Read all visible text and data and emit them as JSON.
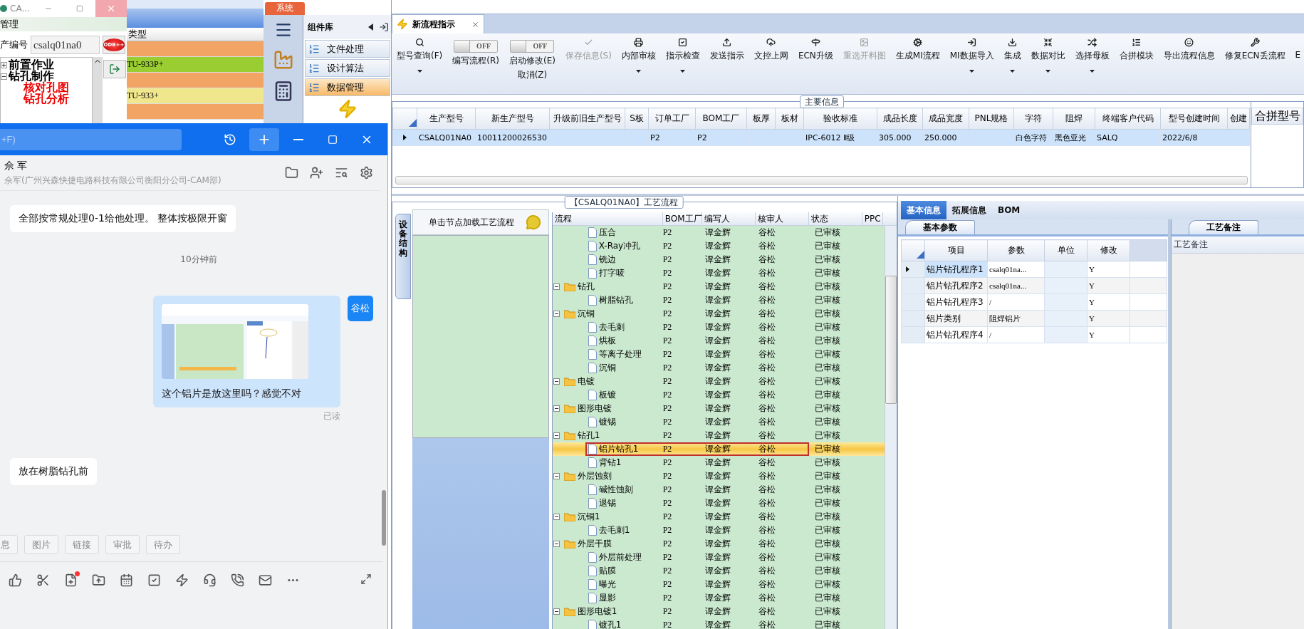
{
  "cam_window": {
    "title": "CA...",
    "section": "管理",
    "field_label": "产编号",
    "field_value": "csalq01na0",
    "odb_label": "ODB++",
    "tree": [
      {
        "label": "前置作业",
        "expanded": false
      },
      {
        "label": "钻孔制作",
        "expanded": true,
        "children": [
          {
            "label": "核对孔图"
          },
          {
            "label": "钻孔分析"
          }
        ]
      }
    ]
  },
  "type_list": {
    "column": "类型",
    "rows": [
      {
        "color": "#f2a464"
      },
      {
        "label": "TU-933P+",
        "color": "#9acd32"
      },
      {
        "color": "#f2a464"
      },
      {
        "label": "TU-933+",
        "color": "#f0e68c"
      },
      {
        "color": "#f2a464"
      }
    ]
  },
  "system_panel": {
    "tab": "系统",
    "library_title": "组件库",
    "items": [
      {
        "label": "文件处理",
        "selected": false
      },
      {
        "label": "设计算法",
        "selected": false
      },
      {
        "label": "数据管理",
        "selected": true
      }
    ]
  },
  "chat": {
    "search_placeholder": "+F)",
    "contact_name": "佘 军",
    "contact_detail": "佘军(广州兴森快捷电路科技有限公司衡阳分公司-CAM部)",
    "messages": [
      {
        "kind": "incoming",
        "text": "全部按常规处理0-1给他处理。 整体按极限开窗"
      },
      {
        "kind": "time",
        "text": "10分钟前"
      },
      {
        "kind": "outgoing",
        "text": "这个铝片是放这里吗？感觉不对",
        "avatar": "谷松",
        "receipt": "已读"
      },
      {
        "kind": "incoming",
        "text": "放在树脂钻孔前"
      }
    ],
    "chips": [
      "息",
      "图片",
      "链接",
      "审批",
      "待办"
    ],
    "notification": true
  },
  "app": {
    "tab": {
      "label": "新流程指示"
    },
    "toolbar": [
      {
        "kind": "button",
        "label": "型号查询(F)",
        "dropdown": true,
        "disabled": false
      },
      {
        "kind": "toggle",
        "label": "编写流程(R)",
        "state_label": "OFF",
        "on": false
      },
      {
        "kind": "toggle",
        "label": "启动修改(E)",
        "label2": "取消(Z)",
        "state_label": "OFF",
        "on": false
      },
      {
        "kind": "button",
        "label": "保存信息(S)",
        "dropdown": false,
        "disabled": true
      },
      {
        "kind": "button",
        "label": "内部审核",
        "dropdown": true,
        "disabled": false
      },
      {
        "kind": "button",
        "label": "指示检查",
        "dropdown": true,
        "disabled": false
      },
      {
        "kind": "button",
        "label": "发送指示",
        "dropdown": false,
        "disabled": false
      },
      {
        "kind": "button",
        "label": "文控上网",
        "dropdown": false,
        "disabled": false
      },
      {
        "kind": "button",
        "label": "ECN升级",
        "dropdown": false,
        "disabled": false
      },
      {
        "kind": "button",
        "label": "重选开料图",
        "dropdown": false,
        "disabled": true
      },
      {
        "kind": "button",
        "label": "生成MI流程",
        "dropdown": false,
        "disabled": false
      },
      {
        "kind": "button",
        "label": "MI数据导入",
        "dropdown": true,
        "disabled": false
      },
      {
        "kind": "button",
        "label": "集成",
        "dropdown": true,
        "disabled": false
      },
      {
        "kind": "button",
        "label": "数据对比",
        "dropdown": true,
        "disabled": false
      },
      {
        "kind": "button",
        "label": "选择母板",
        "dropdown": true,
        "disabled": false
      },
      {
        "kind": "button",
        "label": "合拼模块",
        "dropdown": false,
        "disabled": false
      },
      {
        "kind": "button",
        "label": "导出流程信息",
        "dropdown": false,
        "disabled": false
      },
      {
        "kind": "button",
        "label": "修复ECN丢流程",
        "dropdown": false,
        "disabled": false
      },
      {
        "kind": "button",
        "label": "E",
        "dropdown": false,
        "disabled": false
      }
    ],
    "main_info": {
      "title": "主要信息",
      "side_title": "合拼型号",
      "columns": [
        "生产型号",
        "新生产型号",
        "升级前旧生产型号",
        "S板",
        "订单工厂",
        "BOM工厂",
        "板厚",
        "板材",
        "验收标准",
        "成品长度",
        "成品宽度",
        "PNL规格",
        "字符",
        "阻焊",
        "终端客户代码",
        "型号创建时间",
        "创建"
      ],
      "rows": [
        {
          "selected": true,
          "cells": [
            "CSALQ01NA0",
            "10011200026530",
            "",
            "",
            "P2",
            "P2",
            "",
            "",
            "IPC-6012 Ⅱ级",
            "305.000",
            "250.000",
            "",
            "白色字符",
            "黑色亚光",
            "SALQ",
            "2022/6/8",
            ""
          ]
        }
      ]
    },
    "process": {
      "title": "【CSALQ01NA0】工艺流程",
      "side_tab": "设备结构",
      "hint": "单击节点加载工艺流程",
      "columns": [
        "流程",
        "BOM工厂",
        "编写人",
        "核审人",
        "状态",
        "PPC"
      ],
      "tree": [
        {
          "kind": "continued",
          "children": [
            {
              "kind": "file",
              "name": "压合",
              "bom": "P2",
              "writer": "谭金辉",
              "reviewer": "谷松",
              "status": "已审核",
              "selected": false
            },
            {
              "kind": "file",
              "name": "X-Ray冲孔",
              "bom": "P2",
              "writer": "谭金辉",
              "reviewer": "谷松",
              "status": "已审核",
              "selected": false
            },
            {
              "kind": "file",
              "name": "铣边",
              "bom": "P2",
              "writer": "谭金辉",
              "reviewer": "谷松",
              "status": "已审核",
              "selected": false
            },
            {
              "kind": "file",
              "name": "打字唛",
              "bom": "P2",
              "writer": "谭金辉",
              "reviewer": "谷松",
              "status": "已审核",
              "selected": false
            }
          ]
        },
        {
          "kind": "folder",
          "name": "钻孔",
          "bom": "P2",
          "writer": "谭金辉",
          "reviewer": "谷松",
          "status": "已审核",
          "selected": false,
          "expanded": true,
          "children": [
            {
              "kind": "file",
              "name": "树脂钻孔",
              "bom": "P2",
              "writer": "谭金辉",
              "reviewer": "谷松",
              "status": "已审核",
              "selected": false
            }
          ]
        },
        {
          "kind": "folder",
          "name": "沉铜",
          "bom": "P2",
          "writer": "谭金辉",
          "reviewer": "谷松",
          "status": "已审核",
          "selected": false,
          "expanded": true,
          "children": [
            {
              "kind": "file",
              "name": "去毛刺",
              "bom": "P2",
              "writer": "谭金辉",
              "reviewer": "谷松",
              "status": "已审核",
              "selected": false
            },
            {
              "kind": "file",
              "name": "烘板",
              "bom": "P2",
              "writer": "谭金辉",
              "reviewer": "谷松",
              "status": "已审核",
              "selected": false
            },
            {
              "kind": "file",
              "name": "等离子处理",
              "bom": "P2",
              "writer": "谭金辉",
              "reviewer": "谷松",
              "status": "已审核",
              "selected": false
            },
            {
              "kind": "file",
              "name": "沉铜",
              "bom": "P2",
              "writer": "谭金辉",
              "reviewer": "谷松",
              "status": "已审核",
              "selected": false
            }
          ]
        },
        {
          "kind": "folder",
          "name": "电镀",
          "bom": "P2",
          "writer": "谭金辉",
          "reviewer": "谷松",
          "status": "已审核",
          "selected": false,
          "expanded": true,
          "children": [
            {
              "kind": "file",
              "name": "板镀",
              "bom": "P2",
              "writer": "谭金辉",
              "reviewer": "谷松",
              "status": "已审核",
              "selected": false
            }
          ]
        },
        {
          "kind": "folder",
          "name": "图形电镀",
          "bom": "P2",
          "writer": "谭金辉",
          "reviewer": "谷松",
          "status": "已审核",
          "selected": false,
          "expanded": true,
          "children": [
            {
              "kind": "file",
              "name": "镀锡",
              "bom": "P2",
              "writer": "谭金辉",
              "reviewer": "谷松",
              "status": "已审核",
              "selected": false
            }
          ]
        },
        {
          "kind": "folder",
          "name": "钻孔1",
          "bom": "P2",
          "writer": "谭金辉",
          "reviewer": "谷松",
          "status": "已审核",
          "selected": false,
          "expanded": true,
          "children": [
            {
              "kind": "file",
              "name": "铝片钻孔1",
              "bom": "P2",
              "writer": "谭金辉",
              "reviewer": "谷松",
              "status": "已审核",
              "selected": true
            },
            {
              "kind": "file",
              "name": "背钻1",
              "bom": "P2",
              "writer": "谭金辉",
              "reviewer": "谷松",
              "status": "已审核",
              "selected": false
            }
          ]
        },
        {
          "kind": "folder",
          "name": "外层蚀刻",
          "bom": "P2",
          "writer": "谭金辉",
          "reviewer": "谷松",
          "status": "已审核",
          "selected": false,
          "expanded": true,
          "children": [
            {
              "kind": "file",
              "name": "碱性蚀刻",
              "bom": "P2",
              "writer": "谭金辉",
              "reviewer": "谷松",
              "status": "已审核",
              "selected": false
            },
            {
              "kind": "file",
              "name": "退锡",
              "bom": "P2",
              "writer": "谭金辉",
              "reviewer": "谷松",
              "status": "已审核",
              "selected": false
            }
          ]
        },
        {
          "kind": "folder",
          "name": "沉铜1",
          "bom": "P2",
          "writer": "谭金辉",
          "reviewer": "谷松",
          "status": "已审核",
          "selected": false,
          "expanded": true,
          "children": [
            {
              "kind": "file",
              "name": "去毛刺1",
              "bom": "P2",
              "writer": "谭金辉",
              "reviewer": "谷松",
              "status": "已审核",
              "selected": false
            }
          ]
        },
        {
          "kind": "folder",
          "name": "外层干膜",
          "bom": "P2",
          "writer": "谭金辉",
          "reviewer": "谷松",
          "status": "已审核",
          "selected": false,
          "expanded": true,
          "children": [
            {
              "kind": "file",
              "name": "外层前处理",
              "bom": "P2",
              "writer": "谭金辉",
              "reviewer": "谷松",
              "status": "已审核",
              "selected": false
            },
            {
              "kind": "file",
              "name": "贴膜",
              "bom": "P2",
              "writer": "谭金辉",
              "reviewer": "谷松",
              "status": "已审核",
              "selected": false
            },
            {
              "kind": "file",
              "name": "曝光",
              "bom": "P2",
              "writer": "谭金辉",
              "reviewer": "谷松",
              "status": "已审核",
              "selected": false
            },
            {
              "kind": "file",
              "name": "显影",
              "bom": "P2",
              "writer": "谭金辉",
              "reviewer": "谷松",
              "status": "已审核",
              "selected": false
            }
          ]
        },
        {
          "kind": "folder",
          "name": "图形电镀1",
          "bom": "P2",
          "writer": "谭金辉",
          "reviewer": "谷松",
          "status": "已审核",
          "selected": false,
          "expanded": true,
          "children": [
            {
              "kind": "file",
              "name": "镀孔1",
              "bom": "P2",
              "writer": "谭金辉",
              "reviewer": "谷松",
              "status": "已审核",
              "selected": false
            }
          ]
        }
      ]
    },
    "detail": {
      "tabs": [
        {
          "label": "基本信息",
          "selected": true
        },
        {
          "label": "拓展信息",
          "selected": false
        },
        {
          "label": "BOM",
          "selected": false
        }
      ],
      "params_tab": "基本参数",
      "columns": [
        "项目",
        "参数",
        "单位",
        "修改"
      ],
      "rows": [
        {
          "selected": true,
          "cells": [
            "铝片钻孔程序1",
            "csalq01na...",
            "",
            "Y"
          ]
        },
        {
          "selected": false,
          "cells": [
            "铝片钻孔程序2",
            "csalq01na...",
            "",
            "Y"
          ]
        },
        {
          "selected": false,
          "cells": [
            "铝片钻孔程序3",
            "/",
            "",
            "Y"
          ]
        },
        {
          "selected": false,
          "cells": [
            "铝片类别",
            "阻焊铝片",
            "",
            "Y"
          ]
        },
        {
          "selected": false,
          "cells": [
            "铝片钻孔程序4",
            "/",
            "",
            "Y"
          ]
        }
      ],
      "notes_tab": "工艺备注",
      "notes_label": "工艺备注"
    }
  }
}
